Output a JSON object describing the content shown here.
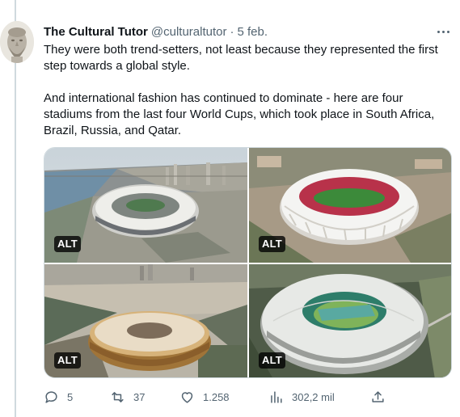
{
  "tweet": {
    "author_name": "The Cultural Tutor",
    "handle": "@culturaltutor",
    "separator": "·",
    "timestamp": "5 feb.",
    "paragraphs": [
      "They were both trend-setters, not least because they represented the first step towards a global style.",
      "And international fashion has continued to dominate - here are four stadiums from the last four World Cups, which took place in South Africa, Brazil, Russia, and Qatar."
    ]
  },
  "media": {
    "images": [
      {
        "alt_badge": "ALT",
        "subject": "stadium-riverside-city"
      },
      {
        "alt_badge": "ALT",
        "subject": "stadium-white-shell-red-seats"
      },
      {
        "alt_badge": "ALT",
        "subject": "stadium-golden-bowl"
      },
      {
        "alt_badge": "ALT",
        "subject": "stadium-white-roof-green-pitch"
      }
    ]
  },
  "actions": {
    "reply": {
      "icon": "reply-icon",
      "count": "5"
    },
    "retweet": {
      "icon": "retweet-icon",
      "count": "37"
    },
    "like": {
      "icon": "heart-icon",
      "count": "1.258"
    },
    "views": {
      "icon": "views-icon",
      "count": "302,2 mil"
    },
    "share": {
      "icon": "share-icon"
    }
  },
  "colors": {
    "text_primary": "#0f1419",
    "text_secondary": "#536471",
    "border": "#cfd9de",
    "alt_badge_bg": "#000000"
  }
}
